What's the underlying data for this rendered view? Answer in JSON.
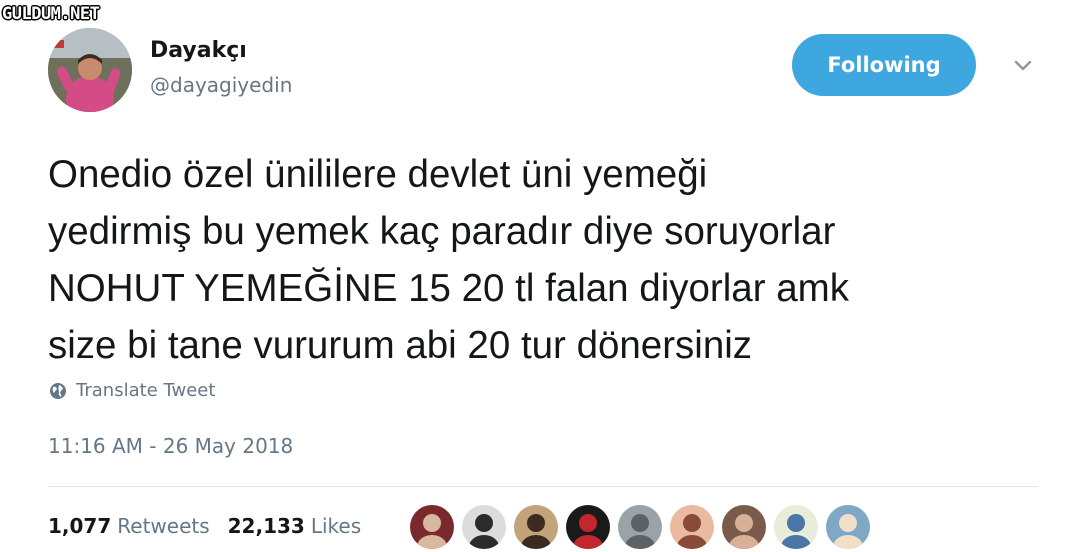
{
  "watermark": "GULDUM.NET",
  "author": {
    "display_name": "Dayakçı",
    "handle": "@dayagiyedin",
    "avatar_icon": "profile-photo"
  },
  "follow_button": {
    "label": "Following",
    "color": "#3fa7e0"
  },
  "menu": {
    "icon": "chevron-down-icon"
  },
  "tweet": {
    "lines": [
      "Onedio özel ünililere devlet üni yemeği",
      "yedirmiş bu yemek kaç paradır diye soruyorlar",
      "NOHUT YEMEĞİNE 15 20 tl falan diyorlar amk",
      "size bi tane vururum abi 20 tur dönersiniz"
    ]
  },
  "translate": {
    "icon": "globe-icon",
    "label": "Translate Tweet"
  },
  "timestamp": "11:16 AM - 26 May 2018",
  "stats": {
    "retweets_count": "1,077",
    "retweets_label": "Retweets",
    "likes_count": "22,133",
    "likes_label": "Likes"
  },
  "likers": [
    {
      "bg": "#7a2a2e",
      "fg": "#d9b8a0"
    },
    {
      "bg": "#dcdcdc",
      "fg": "#2b2b2b"
    },
    {
      "bg": "#c4a27a",
      "fg": "#3a2a20"
    },
    {
      "bg": "#1a1a1a",
      "fg": "#c2262e"
    },
    {
      "bg": "#9aa3a8",
      "fg": "#5b6368"
    },
    {
      "bg": "#e9b9a0",
      "fg": "#8a4a38"
    },
    {
      "bg": "#7a5a4a",
      "fg": "#d8b098"
    },
    {
      "bg": "#e8ecd8",
      "fg": "#4a76a8"
    },
    {
      "bg": "#7fa8c8",
      "fg": "#f0e0c8"
    }
  ],
  "colors": {
    "text": "#14171a",
    "secondary": "#657786",
    "accent": "#3fa7e0",
    "divider": "#e1e8ed"
  }
}
